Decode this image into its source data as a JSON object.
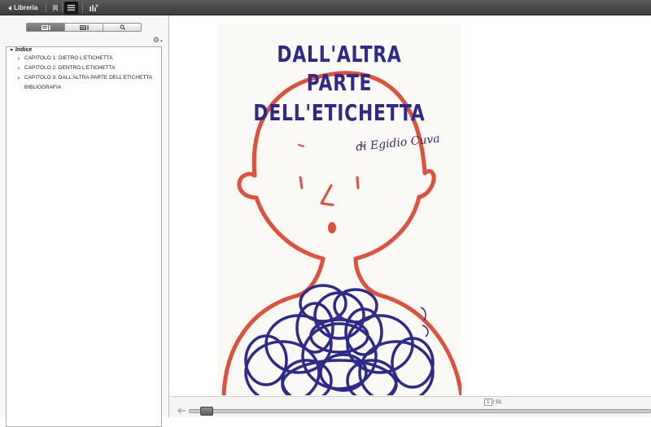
{
  "toolbar": {
    "back_label": "Libreria",
    "buttons": [
      {
        "icon": "bookmark-icon"
      },
      {
        "icon": "list-view-icon",
        "active": true
      },
      {
        "icon": "add-bookmark-icon"
      }
    ]
  },
  "sidebar": {
    "segments": [
      {
        "icon": "toc-icon",
        "active": true
      },
      {
        "icon": "thumbnails-icon"
      },
      {
        "icon": "search-icon"
      }
    ],
    "toc": {
      "root_label": "Indice",
      "items": [
        {
          "label": "CAPITOLO 1: DIETRO L'ETICHETTA",
          "expandable": true
        },
        {
          "label": "CAPITOLO 2: DENTRO L'ETICHETTA",
          "expandable": true
        },
        {
          "label": "CAPITOLO 3: DALL'ALTRA PARTE DELL'ETICHETTA",
          "expandable": true
        },
        {
          "label": "BIBLIOGRAFIA",
          "expandable": false
        }
      ]
    }
  },
  "cover": {
    "title_lines": [
      "DALL'ALTRA",
      "PARTE",
      "DELL'ETICHETTA"
    ],
    "author": "di Egidio Cuva"
  },
  "pager": {
    "current_page": "1",
    "total_pages": "/ 51"
  },
  "colors": {
    "ink_blue": "#2d2a8c",
    "outline_red": "#e0503a"
  }
}
